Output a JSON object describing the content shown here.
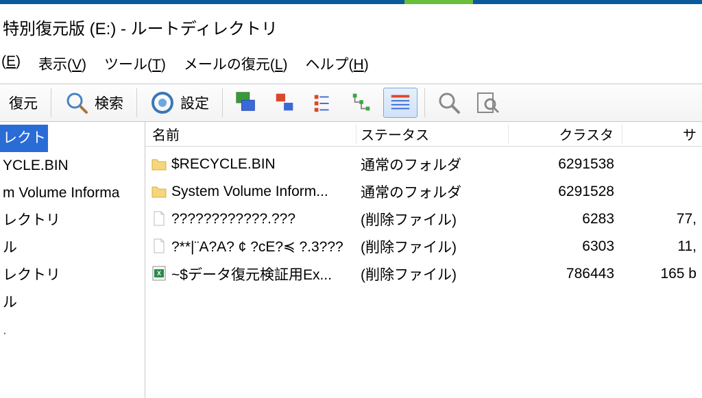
{
  "title": "特別復元版 (E:) - ルートディレクトリ",
  "menu": {
    "edit": {
      "label": "(E)"
    },
    "view": {
      "label": "表示(V)",
      "key": "V"
    },
    "tools": {
      "label": "ツール(T)",
      "key": "T"
    },
    "mail": {
      "label": "メールの復元(L)",
      "key": "L"
    },
    "help": {
      "label": "ヘルプ(H)",
      "key": "H"
    }
  },
  "toolbar": {
    "restore": "復元",
    "search": "検索",
    "settings": "設定"
  },
  "tree": [
    {
      "label": "レクトリ",
      "selected": true
    },
    {
      "label": "YCLE.BIN"
    },
    {
      "label": "m Volume Informa"
    },
    {
      "label": "レクトリ"
    },
    {
      "label": "ル"
    },
    {
      "label": "レクトリ"
    },
    {
      "label": "ル"
    },
    {
      "label": ".",
      "orange": true
    }
  ],
  "columns": {
    "name": "名前",
    "status": "ステータス",
    "cluster": "クラスタ",
    "size": "サ"
  },
  "rows": [
    {
      "icon": "folder",
      "name": "$RECYCLE.BIN",
      "status": "通常のフォルダ",
      "cluster": "6291538",
      "size": ""
    },
    {
      "icon": "folder",
      "name": "System Volume Inform...",
      "status": "通常のフォルダ",
      "cluster": "6291528",
      "size": ""
    },
    {
      "icon": "file",
      "name": "????????????.???",
      "status": "(削除ファイル)",
      "cluster": "6283",
      "size": "77,"
    },
    {
      "icon": "file",
      "name": "?**|¨A?A? ¢ ?cE?≼ ?.3???",
      "status": "(削除ファイル)",
      "cluster": "6303",
      "size": "11,"
    },
    {
      "icon": "excel",
      "name": "~$データ復元検証用Ex...",
      "status": "(削除ファイル)",
      "cluster": "786443",
      "size": "165 b"
    }
  ]
}
